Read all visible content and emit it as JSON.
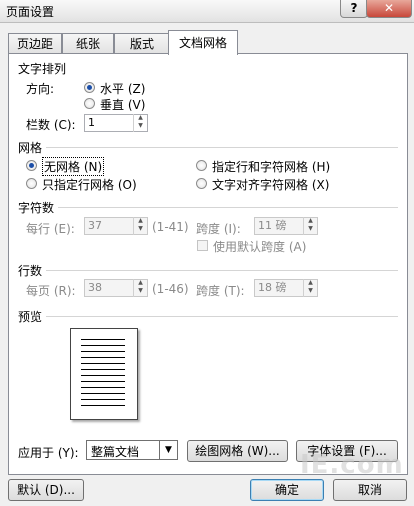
{
  "window": {
    "title": "页面设置",
    "help": "?",
    "close": "✕"
  },
  "tabs": [
    "页边距",
    "纸张",
    "版式",
    "文档网格"
  ],
  "text_direction": {
    "header": "文字排列",
    "orientation_label": "方向:",
    "horizontal": "水平 (Z)",
    "vertical": "垂直 (V)",
    "columns_label": "栏数 (C):",
    "columns_value": "1"
  },
  "grid": {
    "header": "网格",
    "no_grid": "无网格 (N)",
    "line_and_char_grid": "指定行和字符网格 (H)",
    "line_grid_only": "只指定行网格 (O)",
    "snap_to_char_grid": "文字对齐字符网格 (X)",
    "selected": "no_grid"
  },
  "characters": {
    "header": "字符数",
    "per_line_label": "每行 (E):",
    "per_line_value": "37",
    "per_line_range": "(1-41)",
    "pitch_label": "跨度 (I):",
    "pitch_value": "11 磅",
    "use_default_pitch": "使用默认跨度 (A)"
  },
  "lines": {
    "header": "行数",
    "per_page_label": "每页 (R):",
    "per_page_value": "38",
    "per_page_range": "(1-46)",
    "pitch_label": "跨度 (T):",
    "pitch_value": "18 磅"
  },
  "preview": {
    "header": "预览"
  },
  "footer": {
    "apply_to_label": "应用于 (Y):",
    "apply_to_value": "整篇文档",
    "drawing_grid_button": "绘图网格 (W)...",
    "font_settings_button": "字体设置 (F)...",
    "default_button": "默认 (D)...",
    "ok_button": "确定",
    "cancel_button": "取消"
  },
  "watermark": "IE.com"
}
